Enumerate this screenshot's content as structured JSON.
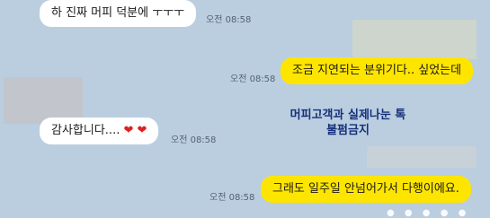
{
  "messages": [
    {
      "text": "하 진짜 머피 덕분에 ㅜㅜㅜ",
      "time": "오전 08:58"
    },
    {
      "text": "조금 지연되는 분위기다.. 싶었는데",
      "time": "오전 08:58"
    },
    {
      "text": "감사합니다....",
      "hearts": "❤ ❤",
      "time": "오전 08:58"
    },
    {
      "text": "그래도 일주일 안넘어가서 다행이에요.",
      "time": "오전 08:58"
    }
  ],
  "overlay": {
    "line1": "머피고객과 실제나눈 톡",
    "line2": "불펌금지"
  },
  "colors": {
    "background": "#bacee0",
    "incoming_bubble": "#ffffff",
    "outgoing_bubble": "#fee500",
    "overlay_text": "#16307a"
  }
}
